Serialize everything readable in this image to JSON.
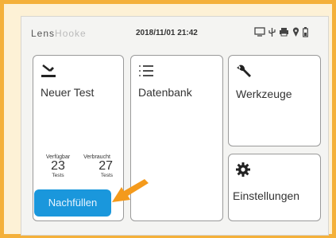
{
  "header": {
    "logo_main": "Lens",
    "logo_light": "Hooke",
    "datetime": "2018/11/01 21:42",
    "status_icons": [
      "display-icon",
      "usb-icon",
      "printer-icon",
      "location-pin-icon",
      "battery-icon"
    ]
  },
  "cards": {
    "new_test": {
      "label": "Neuer Test",
      "icon": "pipette-icon",
      "available_label": "Verfügbar",
      "used_label": "Verbraucht",
      "available_count": "23",
      "used_count": "27",
      "unit": "Tests",
      "refill_label": "Nachfüllen"
    },
    "database": {
      "label": "Datenbank",
      "icon": "list-icon"
    },
    "tools": {
      "label": "Werkzeuge",
      "icon": "wrench-icon"
    },
    "settings": {
      "label": "Einstellungen",
      "icon": "gear-icon"
    }
  },
  "colors": {
    "accent_button": "#1a97dc",
    "highlight_arrow": "#f49a1c",
    "frame_border": "#f4b03a"
  }
}
